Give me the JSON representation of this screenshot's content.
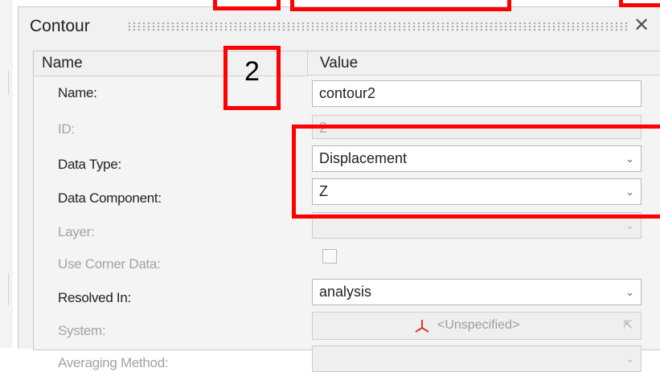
{
  "panel": {
    "title": "Contour",
    "close_glyph": "✕"
  },
  "table": {
    "col_name": "Name",
    "col_value": "Value"
  },
  "rows": {
    "name": {
      "label": "Name:",
      "value": "contour2"
    },
    "id": {
      "label": "ID:",
      "value": "2"
    },
    "data_type": {
      "label": "Data Type:",
      "value": "Displacement"
    },
    "data_component": {
      "label": "Data Component:",
      "value": "Z"
    },
    "layer": {
      "label": "Layer:",
      "value": ""
    },
    "use_corner_data": {
      "label": "Use Corner Data:",
      "checked": false
    },
    "resolved_in": {
      "label": "Resolved In:",
      "value": "analysis"
    },
    "system": {
      "label": "System:",
      "value": "<Unspecified>"
    },
    "averaging": {
      "label": "Averaging Method:",
      "value": ""
    }
  },
  "annotation": {
    "badge": "2",
    "highlight_color": "#ff0000"
  },
  "icons": {
    "close": "close-icon",
    "dropdown": "chevron-down-icon",
    "system": "coordinate-system-icon",
    "picker": "pointer-icon"
  },
  "glyphs": {
    "caret": "⌄",
    "picker": "⇱"
  }
}
